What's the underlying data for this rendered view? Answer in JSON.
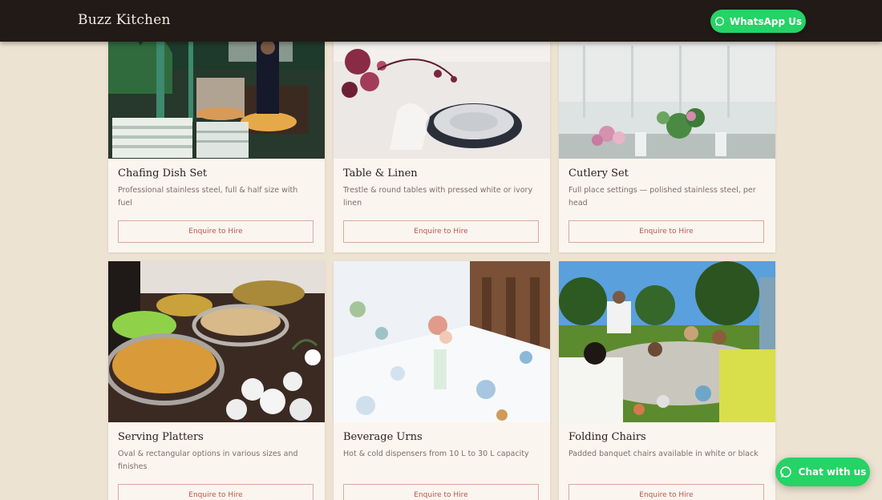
{
  "header": {
    "brand": "Buzz Kitchen",
    "whatsapp_label": "WhatsApp Us"
  },
  "cards": [
    {
      "title": "Chafing Dish Set",
      "description": "Professional stainless steel, full & half size with fuel",
      "button_label": "Enquire to Hire"
    },
    {
      "title": "Table & Linen",
      "description": "Trestle & round tables with pressed white or ivory linen",
      "button_label": "Enquire to Hire"
    },
    {
      "title": "Cutlery Set",
      "description": "Full place settings — polished stainless steel, per head",
      "button_label": "Enquire to Hire"
    },
    {
      "title": "Serving Platters",
      "description": "Oval & rectangular options in various sizes and finishes",
      "button_label": "Enquire to Hire"
    },
    {
      "title": "Beverage Urns",
      "description": "Hot & cold dispensers from 10 L to 30 L capacity",
      "button_label": "Enquire to Hire"
    },
    {
      "title": "Folding Chairs",
      "description": "Padded banquet chairs available in white or black",
      "button_label": "Enquire to Hire"
    }
  ],
  "chat": {
    "label": "Chat with us"
  },
  "colors": {
    "header_bg": "#221a16",
    "page_bg": "#ede3d3",
    "card_bg": "#fbf5ef",
    "whatsapp_green": "#25d366",
    "accent_rose": "#b4574b"
  },
  "icons": {
    "whatsapp": "whatsapp-icon",
    "chat": "chat-bubble-icon"
  }
}
